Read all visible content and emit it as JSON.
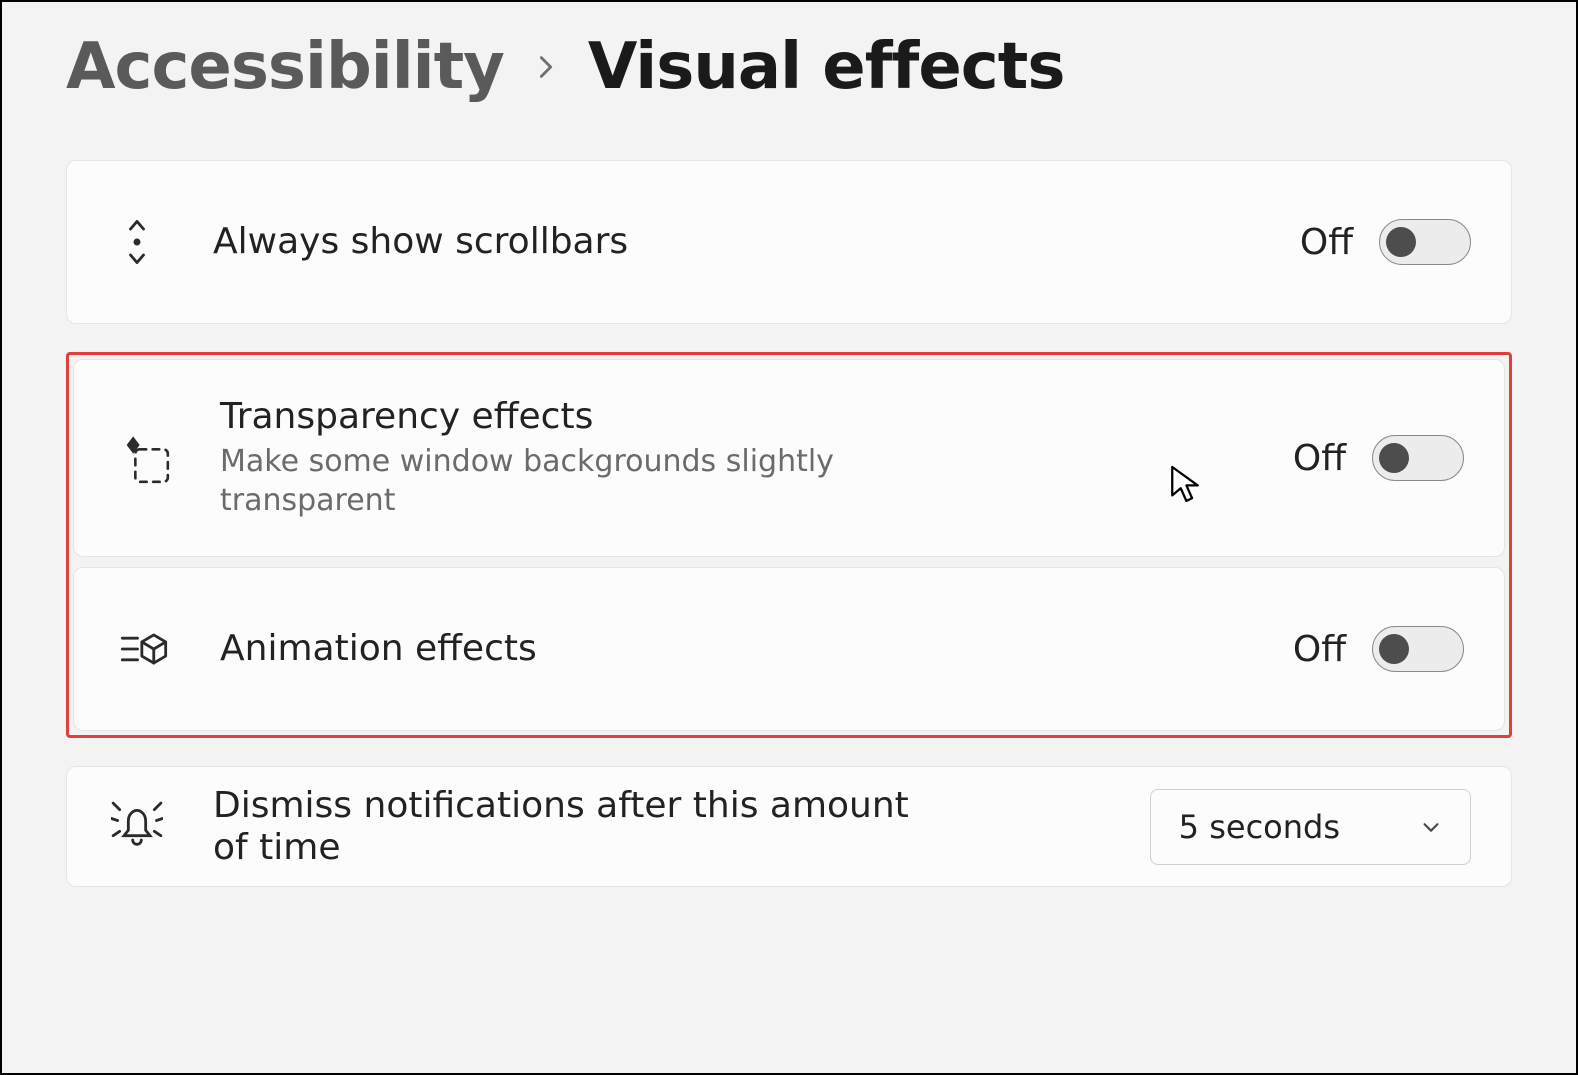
{
  "breadcrumb": {
    "parent": "Accessibility",
    "current": "Visual effects"
  },
  "cards": {
    "scrollbars": {
      "title": "Always show scrollbars",
      "state": "Off"
    },
    "transparency": {
      "title": "Transparency effects",
      "desc": "Make some window backgrounds slightly transparent",
      "state": "Off"
    },
    "animation": {
      "title": "Animation effects",
      "state": "Off"
    },
    "dismiss": {
      "title": "Dismiss notifications after this amount of time",
      "select_value": "5 seconds"
    }
  }
}
